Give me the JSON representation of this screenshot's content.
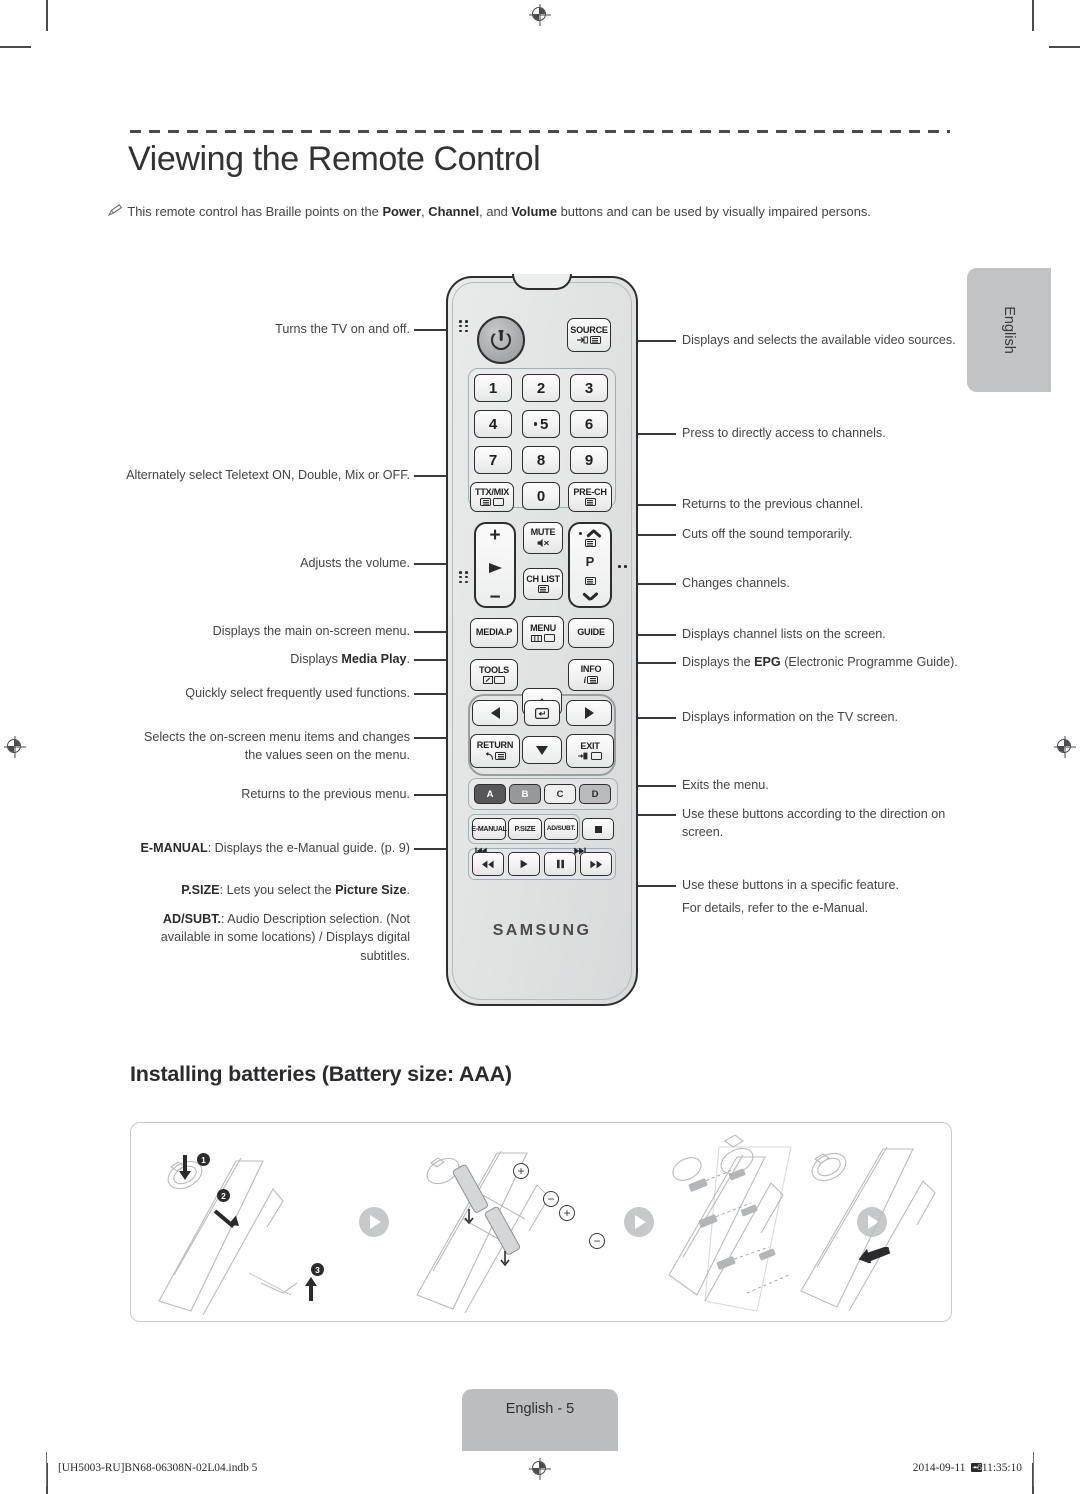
{
  "document": {
    "title": "Viewing the Remote Control",
    "language_tab": "English",
    "note": {
      "icon": "pencil-note-icon",
      "text_part1": "This remote control has Braille points on the ",
      "bold1": "Power",
      "text_part2": ", ",
      "bold2": "Channel",
      "text_part3": ", and ",
      "bold3": "Volume",
      "text_part4": " buttons and can be used by visually impaired persons."
    }
  },
  "callouts_left": [
    {
      "id": "power",
      "text": "Turns the TV on and off."
    },
    {
      "id": "ttxmix",
      "text": "Alternately select Teletext ON, Double, Mix or OFF."
    },
    {
      "id": "volume",
      "text": "Adjusts the volume."
    },
    {
      "id": "menu",
      "text": "Displays the main on-screen menu."
    },
    {
      "id": "mediap",
      "pre": "Displays ",
      "bold": "Media Play",
      "post": "."
    },
    {
      "id": "tools",
      "text": "Quickly select frequently used functions."
    },
    {
      "id": "nav",
      "text": "Selects the on-screen menu items and changes the values seen on the menu."
    },
    {
      "id": "return",
      "text": "Returns to the previous menu."
    },
    {
      "id": "emanual",
      "bold": "E-MANUAL",
      "post": ": Displays the e-Manual guide. (p. 9)"
    },
    {
      "id": "psize",
      "bold": "P.SIZE",
      "mid": ": Lets you select the ",
      "bold2": "Picture Size",
      "post": "."
    },
    {
      "id": "adsubt",
      "bold": "AD/SUBT.",
      "post": ": Audio Description selection. (Not available in some locations) / Displays digital subtitles."
    }
  ],
  "callouts_right": [
    {
      "id": "source",
      "text": "Displays and selects the available video sources."
    },
    {
      "id": "numeric",
      "text": "Press to directly access to channels."
    },
    {
      "id": "prech",
      "text": "Returns to the previous channel."
    },
    {
      "id": "mute",
      "text": "Cuts off the sound temporarily."
    },
    {
      "id": "channel",
      "text": "Changes channels."
    },
    {
      "id": "chlist",
      "text": "Displays channel lists on the screen."
    },
    {
      "id": "guide",
      "pre": "Displays the ",
      "bold": "EPG",
      "post": " (Electronic Programme Guide)."
    },
    {
      "id": "info",
      "text": "Displays information on the TV screen."
    },
    {
      "id": "exit",
      "text": "Exits the menu."
    },
    {
      "id": "abcd",
      "text": "Use these buttons according to the direction on screen."
    },
    {
      "id": "media",
      "text": "Use these buttons in a specific feature."
    },
    {
      "id": "media2",
      "text": "For details, refer to the e-Manual."
    }
  ],
  "remote": {
    "brand": "SAMSUNG",
    "power_button": {
      "label": "",
      "icon": "power-icon"
    },
    "source_button": {
      "label": "SOURCE",
      "icon": "source-icon"
    },
    "numeric_keys": [
      "1",
      "2",
      "3",
      "4",
      "5",
      "6",
      "7",
      "8",
      "9",
      "0"
    ],
    "ttxmix_button": {
      "label": "TTX/MIX",
      "icon": "teletext-icon"
    },
    "prech_button": {
      "label": "PRE-CH",
      "icon": "prech-icon"
    },
    "mute_button": {
      "label": "MUTE",
      "icon": "mute-icon"
    },
    "chlist_button": {
      "label": "CH LIST",
      "icon": "chlist-icon"
    },
    "volume_rocker": {
      "plus": "+",
      "minus": "−",
      "icon": "speaker-icon"
    },
    "channel_rocker": {
      "label": "P",
      "icon_up": "chevron-up-icon",
      "icon_down": "chevron-down-icon"
    },
    "mediap_button": {
      "label": "MEDIA.P"
    },
    "menu_button": {
      "label": "MENU",
      "icon": "menu-icon"
    },
    "guide_button": {
      "label": "GUIDE"
    },
    "tools_button": {
      "label": "TOOLS",
      "icon": "tools-icon"
    },
    "info_button": {
      "label": "INFO",
      "icon": "info-icon"
    },
    "return_button": {
      "label": "RETURN",
      "icon": "return-icon"
    },
    "exit_button": {
      "label": "EXIT",
      "icon": "exit-icon"
    },
    "enter_button": {
      "icon": "enter-icon"
    },
    "color_buttons": [
      {
        "label": "A",
        "color": "#57575a"
      },
      {
        "label": "B",
        "color": "#97989a"
      },
      {
        "label": "C",
        "color": "#efefef"
      },
      {
        "label": "D",
        "color": "#b9babb"
      }
    ],
    "function_buttons": [
      "E-MANUAL",
      "P.SIZE",
      "AD/SUBT."
    ],
    "stop_button": {
      "icon": "stop-icon"
    },
    "transport_buttons": [
      {
        "icon": "rewind-icon",
        "over": "skip-previous-icon"
      },
      {
        "icon": "play-icon",
        "over": ""
      },
      {
        "icon": "pause-icon",
        "over": ""
      },
      {
        "icon": "fastforward-icon",
        "over": "skip-next-icon"
      }
    ]
  },
  "batteries": {
    "heading": "Installing batteries (Battery size: AAA)",
    "steps": [
      "1",
      "2",
      "3"
    ],
    "polarity": [
      "+",
      "−",
      "+",
      "−"
    ],
    "flow_arrows": 3
  },
  "footer": {
    "page_label": "English - 5",
    "file_ref": "[UH5003-RU]BN68-06308N-02L04.indb   5",
    "date": "2014-09-11",
    "time": "11:35:10",
    "time_marker": "⥇5"
  }
}
